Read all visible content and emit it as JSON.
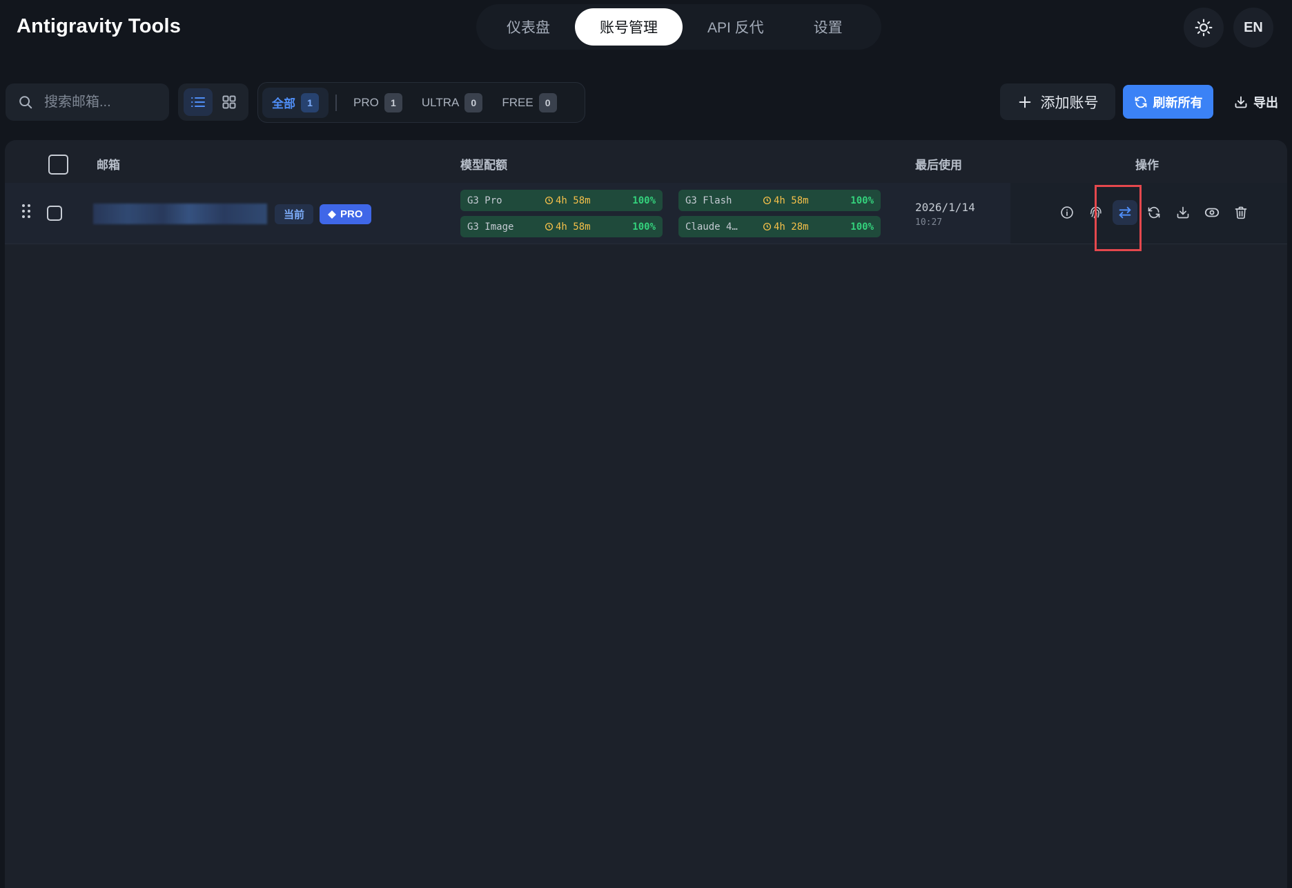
{
  "header": {
    "app_title": "Antigravity Tools",
    "nav_tabs": [
      {
        "label": "仪表盘",
        "active": false
      },
      {
        "label": "账号管理",
        "active": true
      },
      {
        "label": "API 反代",
        "active": false
      },
      {
        "label": "设置",
        "active": false
      }
    ],
    "theme_icon": "sun-icon",
    "language_label": "EN"
  },
  "toolbar": {
    "search": {
      "placeholder": "搜索邮箱...",
      "value": ""
    },
    "view_modes": [
      {
        "icon": "list-icon",
        "active": true
      },
      {
        "icon": "grid-icon",
        "active": false
      }
    ],
    "filters": [
      {
        "label": "全部",
        "count": "1",
        "active": true
      },
      {
        "label": "PRO",
        "count": "1",
        "active": false
      },
      {
        "label": "ULTRA",
        "count": "0",
        "active": false
      },
      {
        "label": "FREE",
        "count": "0",
        "active": false
      }
    ],
    "add_label": "添加账号",
    "refresh_label": "刷新所有",
    "export_label": "导出"
  },
  "table": {
    "columns": {
      "email": "邮箱",
      "quota": "模型配额",
      "last_used": "最后使用",
      "actions": "操作"
    },
    "rows": [
      {
        "badge_current": "当前",
        "badge_tier": "PRO",
        "quotas": [
          {
            "name": "G3 Pro",
            "time": "4h 58m",
            "percent": "100%"
          },
          {
            "name": "G3 Flash",
            "time": "4h 58m",
            "percent": "100%"
          },
          {
            "name": "G3 Image",
            "time": "4h 58m",
            "percent": "100%"
          },
          {
            "name": "Claude 4…",
            "time": "4h 28m",
            "percent": "100%"
          }
        ],
        "last_used_date": "2026/1/14",
        "last_used_time": "10:27",
        "actions": [
          "info-icon",
          "fingerprint-icon",
          "switch-icon",
          "refresh-icon",
          "download-icon",
          "eye-icon",
          "trash-icon"
        ]
      }
    ]
  },
  "colors": {
    "accent": "#3b82f6",
    "quota_bg": "#1f4a3b",
    "quota_percent": "#34d17c",
    "quota_time": "#f5c04a",
    "highlight_box": "#e5484d"
  }
}
